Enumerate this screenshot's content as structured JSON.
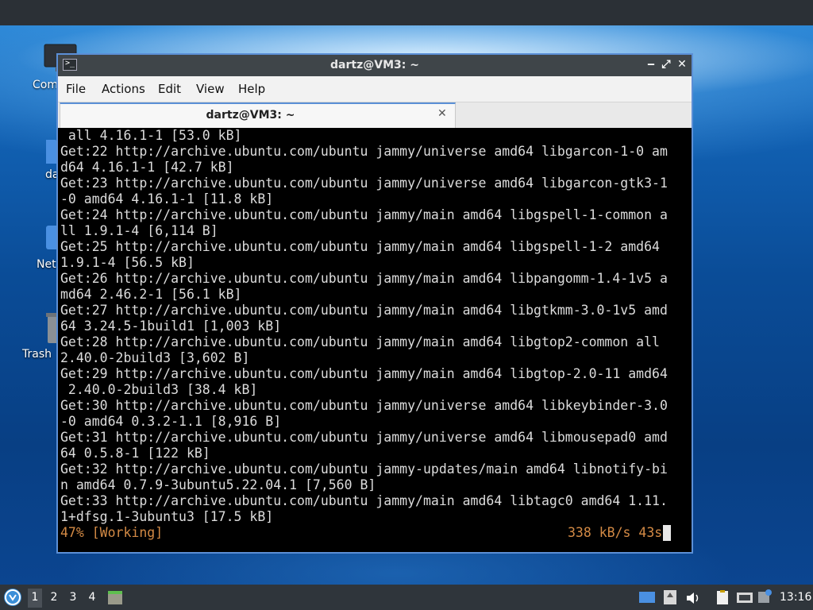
{
  "desktop": {
    "icons": [
      {
        "label": "Com",
        "icon": "computer-icon"
      },
      {
        "label": "da",
        "icon": "folder-icon"
      },
      {
        "label": "Net",
        "icon": "network-icon"
      },
      {
        "label": "Trash",
        "icon": "trash-icon"
      }
    ]
  },
  "window": {
    "title": "dartz@VM3: ~",
    "buttons": {
      "minimize": "‒",
      "maximize": "⤢",
      "close": "✕"
    }
  },
  "menu": {
    "file": "File",
    "actions": "Actions",
    "edit": "Edit",
    "view": "View",
    "help": "Help"
  },
  "tab": {
    "label": "dartz@VM3: ~",
    "close": "✕"
  },
  "terminal": {
    "lines": [
      " all 4.16.1-1 [53.0 kB]",
      "Get:22 http://archive.ubuntu.com/ubuntu jammy/universe amd64 libgarcon-1-0 am",
      "d64 4.16.1-1 [42.7 kB]",
      "Get:23 http://archive.ubuntu.com/ubuntu jammy/universe amd64 libgarcon-gtk3-1",
      "-0 amd64 4.16.1-1 [11.8 kB]",
      "Get:24 http://archive.ubuntu.com/ubuntu jammy/main amd64 libgspell-1-common a",
      "ll 1.9.1-4 [6,114 B]",
      "Get:25 http://archive.ubuntu.com/ubuntu jammy/main amd64 libgspell-1-2 amd64",
      "1.9.1-4 [56.5 kB]",
      "Get:26 http://archive.ubuntu.com/ubuntu jammy/main amd64 libpangomm-1.4-1v5 a",
      "md64 2.46.2-1 [56.1 kB]",
      "Get:27 http://archive.ubuntu.com/ubuntu jammy/main amd64 libgtkmm-3.0-1v5 amd",
      "64 3.24.5-1build1 [1,003 kB]",
      "Get:28 http://archive.ubuntu.com/ubuntu jammy/main amd64 libgtop2-common all",
      "2.40.0-2build3 [3,602 B]",
      "Get:29 http://archive.ubuntu.com/ubuntu jammy/main amd64 libgtop-2.0-11 amd64",
      " 2.40.0-2build3 [38.4 kB]",
      "Get:30 http://archive.ubuntu.com/ubuntu jammy/universe amd64 libkeybinder-3.0",
      "-0 amd64 0.3.2-1.1 [8,916 B]",
      "Get:31 http://archive.ubuntu.com/ubuntu jammy/universe amd64 libmousepad0 amd",
      "64 0.5.8-1 [122 kB]",
      "Get:32 http://archive.ubuntu.com/ubuntu jammy-updates/main amd64 libnotify-bi",
      "n amd64 0.7.9-3ubuntu5.22.04.1 [7,560 B]",
      "Get:33 http://archive.ubuntu.com/ubuntu jammy/main amd64 libtagc0 amd64 1.11.",
      "1+dfsg.1-3ubuntu3 [17.5 kB]"
    ],
    "status": "47% [Working]",
    "rate": "338 kB/s 43s",
    "colors": {
      "background": "#000000",
      "text": "#dcdcdc",
      "status": "#d38a45"
    }
  },
  "taskbar": {
    "workspaces": [
      "1",
      "2",
      "3",
      "4"
    ],
    "active_workspace": "1",
    "clock": "13:16"
  }
}
